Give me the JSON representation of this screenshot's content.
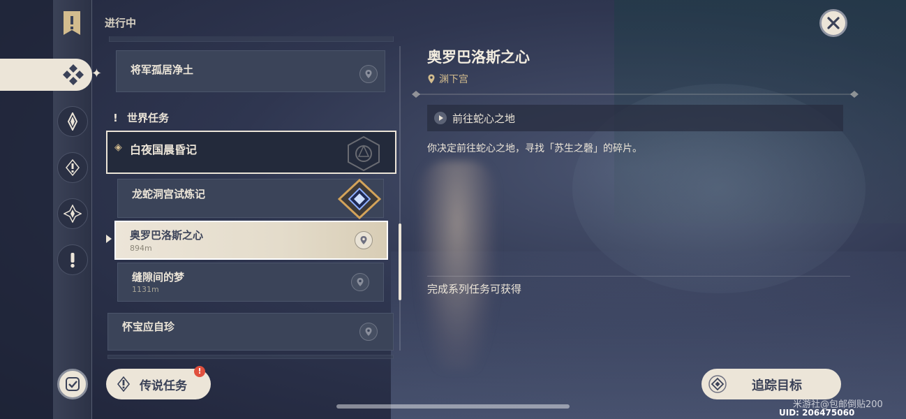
{
  "header": {
    "title": "进行中"
  },
  "list": {
    "top_item": {
      "label": "将军孤居净土"
    },
    "section": {
      "icon": "exclamation-icon",
      "label": "世界任务"
    },
    "chapter": {
      "label": "白夜国晨昏记"
    },
    "items": [
      {
        "label": "龙蛇洞宫试炼记",
        "distance": ""
      },
      {
        "label": "奥罗巴洛斯之心",
        "distance": "894m",
        "selected": true
      },
      {
        "label": "缝隙间的梦",
        "distance": "1131m"
      }
    ],
    "bottom_item": {
      "label": "怀宝应自珍"
    }
  },
  "legend_button": {
    "label": "传说任务",
    "badge": "!"
  },
  "detail": {
    "title": "奥罗巴洛斯之心",
    "location": "渊下宫",
    "step": "前往蛇心之地",
    "description": "你决定前往蛇心之地，寻找「苏生之磬」的碎片。",
    "reward_note": "完成系列任务可获得"
  },
  "track_button": {
    "label": "追踪目标"
  },
  "watermark": "米游社@包邮倒贴200",
  "uid": "UID: 206475060",
  "colors": {
    "accent": "#ece5d8",
    "gold": "#d3bc8e",
    "panel": "#3b4459",
    "badge": "#e0503e"
  }
}
